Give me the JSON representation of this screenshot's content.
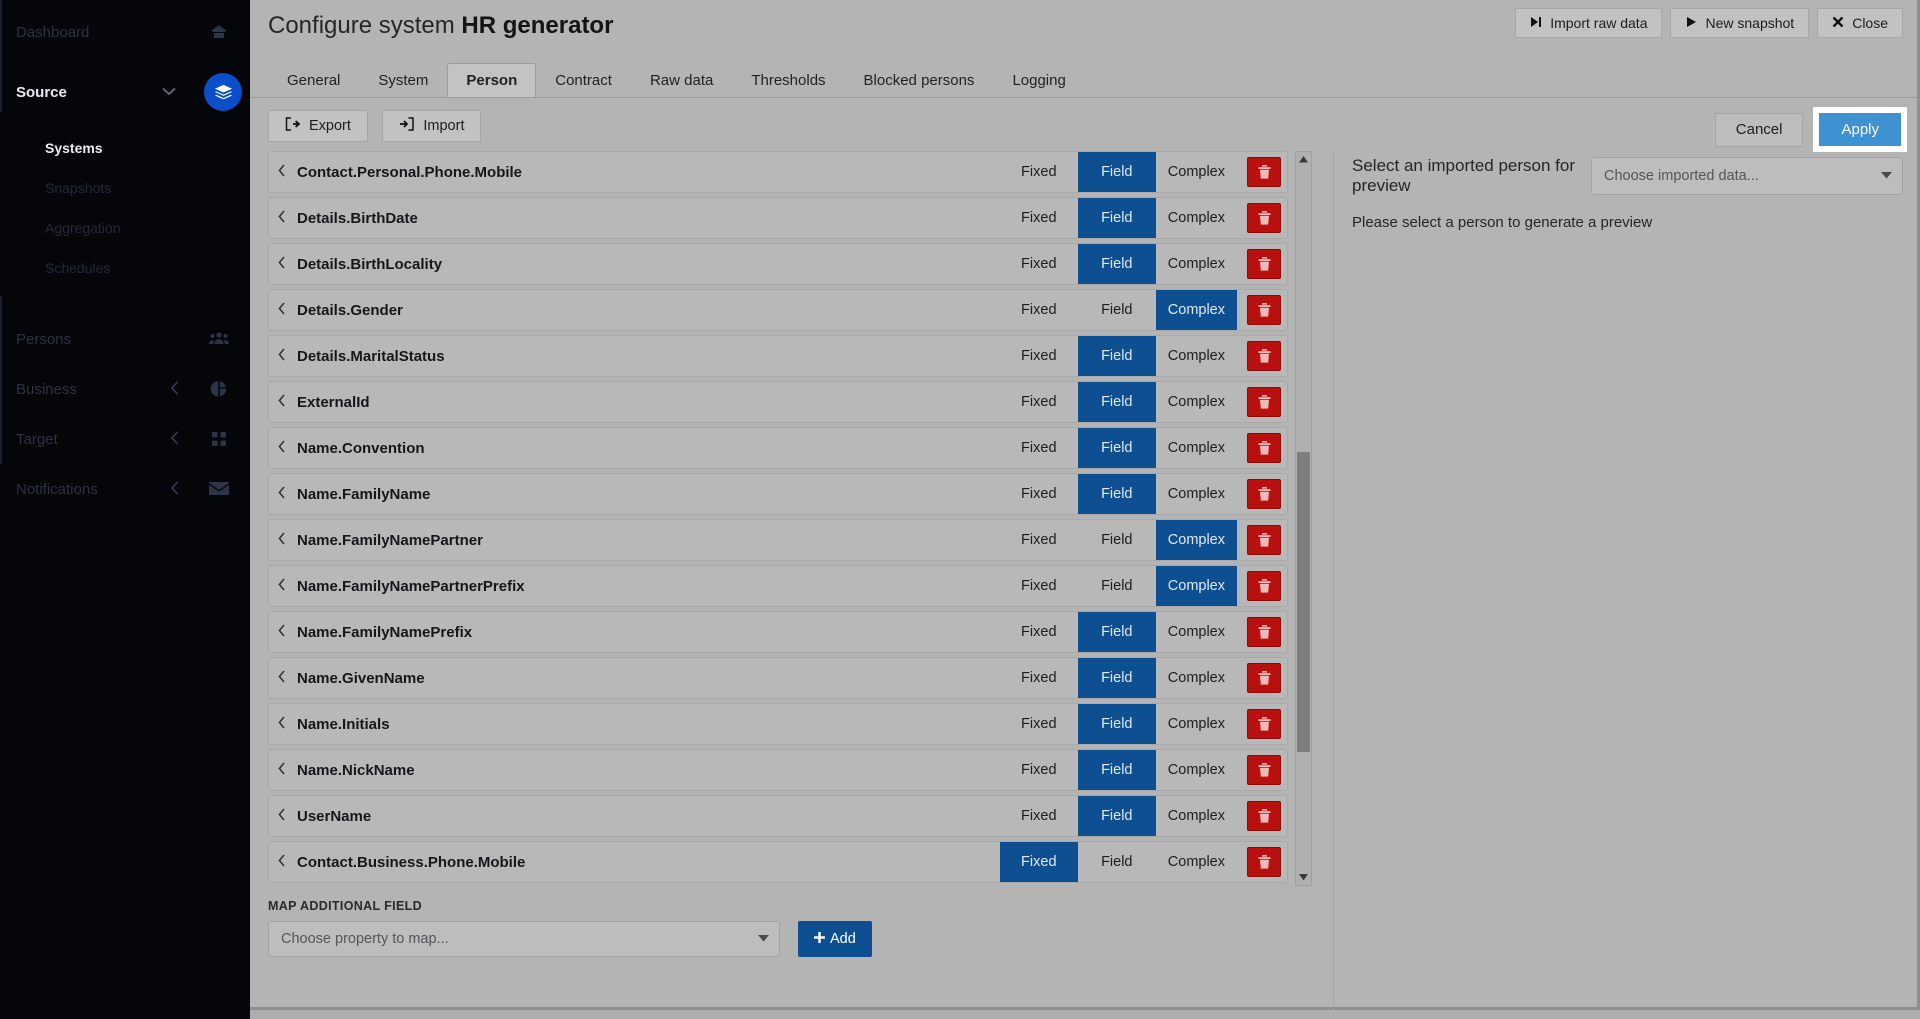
{
  "sidebar": {
    "items": [
      {
        "label": "Dashboard",
        "icon": "home-icon",
        "state": "dim",
        "chevron": ""
      },
      {
        "label": "Source",
        "icon": "layers-icon",
        "state": "active",
        "chevron": "v"
      }
    ],
    "source_sub_items": [
      {
        "label": "Systems",
        "selected": true
      },
      {
        "label": "Snapshots",
        "selected": false
      },
      {
        "label": "Aggregation",
        "selected": false
      },
      {
        "label": "Schedules",
        "selected": false
      }
    ],
    "lower_items": [
      {
        "label": "Persons",
        "icon": "users-icon",
        "chevron": ""
      },
      {
        "label": "Business",
        "icon": "pie-chart-icon",
        "chevron": "<"
      },
      {
        "label": "Target",
        "icon": "grid-icon",
        "chevron": "<"
      },
      {
        "label": "Notifications",
        "icon": "envelope-icon",
        "chevron": "<"
      }
    ]
  },
  "modal": {
    "title_prefix": "Configure system ",
    "title_name": "HR generator",
    "head_buttons": [
      {
        "label": "Import raw data",
        "icon": "skip-to-end-icon",
        "glyph": "▶|"
      },
      {
        "label": "New snapshot",
        "icon": "play-icon",
        "glyph": "▶"
      },
      {
        "label": "Close",
        "icon": "close-icon",
        "glyph": "✖"
      }
    ],
    "tabs": [
      {
        "label": "General",
        "selected": false
      },
      {
        "label": "System",
        "selected": false
      },
      {
        "label": "Person",
        "selected": true
      },
      {
        "label": "Contract",
        "selected": false
      },
      {
        "label": "Raw data",
        "selected": false
      },
      {
        "label": "Thresholds",
        "selected": false
      },
      {
        "label": "Blocked persons",
        "selected": false
      },
      {
        "label": "Logging",
        "selected": false
      }
    ]
  },
  "toolbar": {
    "export_label": "Export",
    "import_label": "Import",
    "cancel_label": "Cancel",
    "apply_label": "Apply"
  },
  "mapping": {
    "option_labels": [
      "Fixed",
      "Field",
      "Complex"
    ],
    "rows": [
      {
        "label": "Contact.Personal.Phone.Mobile",
        "selected": "Field"
      },
      {
        "label": "Details.BirthDate",
        "selected": "Field"
      },
      {
        "label": "Details.BirthLocality",
        "selected": "Field"
      },
      {
        "label": "Details.Gender",
        "selected": "Complex"
      },
      {
        "label": "Details.MaritalStatus",
        "selected": "Field"
      },
      {
        "label": "ExternalId",
        "selected": "Field"
      },
      {
        "label": "Name.Convention",
        "selected": "Field"
      },
      {
        "label": "Name.FamilyName",
        "selected": "Field"
      },
      {
        "label": "Name.FamilyNamePartner",
        "selected": "Complex"
      },
      {
        "label": "Name.FamilyNamePartnerPrefix",
        "selected": "Complex"
      },
      {
        "label": "Name.FamilyNamePrefix",
        "selected": "Field"
      },
      {
        "label": "Name.GivenName",
        "selected": "Field"
      },
      {
        "label": "Name.Initials",
        "selected": "Field"
      },
      {
        "label": "Name.NickName",
        "selected": "Field"
      },
      {
        "label": "UserName",
        "selected": "Field"
      },
      {
        "label": "Contact.Business.Phone.Mobile",
        "selected": "Fixed"
      }
    ],
    "map_field_label": "MAP ADDITIONAL FIELD",
    "map_field_placeholder": "Choose property to map...",
    "add_label": "Add"
  },
  "preview": {
    "head_label": "Select an imported person for preview",
    "select_placeholder": "Choose imported data...",
    "empty_message": "Please select a person to generate a preview"
  },
  "colors": {
    "accent_blue": "#0d4f90",
    "apply_blue": "#3f92d2",
    "danger_red": "#b80f0f",
    "sidebar_bg": "#05060a",
    "modal_bg": "#b4b4b4"
  }
}
